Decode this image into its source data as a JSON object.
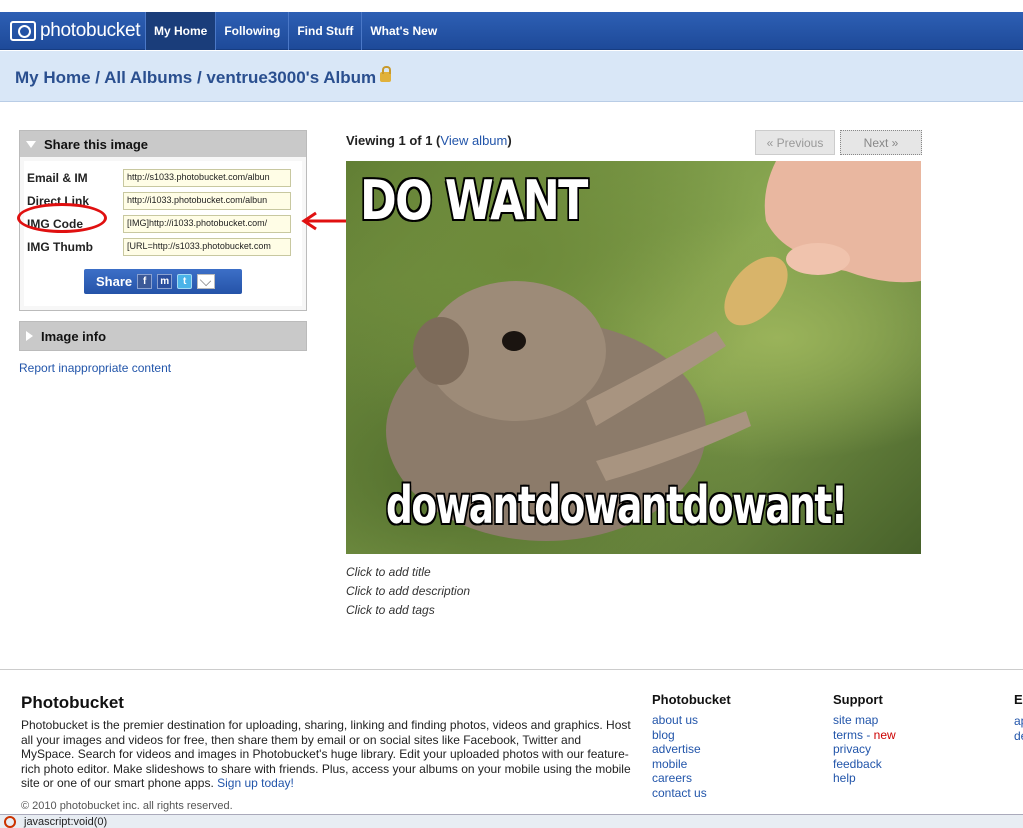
{
  "header": {
    "logo_text": "photobucket",
    "nav": [
      "My Home",
      "Following",
      "Find Stuff",
      "What's New"
    ]
  },
  "breadcrumb": {
    "text": "My Home / All Albums / ventrue3000's Album"
  },
  "share": {
    "title": "Share this image",
    "rows": [
      {
        "label": "Email & IM",
        "value": "http://s1033.photobucket.com/albun"
      },
      {
        "label": "Direct Link",
        "value": "http://i1033.photobucket.com/albun"
      },
      {
        "label": "IMG Code",
        "value": "[IMG]http://i1033.photobucket.com/"
      },
      {
        "label": "IMG Thumb",
        "value": "[URL=http://s1033.photobucket.com"
      }
    ],
    "button_label": "Share",
    "icons": [
      "facebook-icon",
      "myspace-icon",
      "twitter-icon",
      "email-icon"
    ]
  },
  "image_info": {
    "title": "Image info"
  },
  "report_link": "Report inappropriate content",
  "viewer": {
    "viewing_text": "Viewing 1 of 1 (",
    "view_album": "View album",
    "viewing_close": ")",
    "prev_label": "« Previous",
    "next_label": "Next »",
    "caption_top": "DO WANT",
    "caption_bottom": "dowantdowantdowant!",
    "add_title": "Click to add title",
    "add_description": "Click to add description",
    "add_tags": "Click to add tags"
  },
  "footer": {
    "title": "Photobucket",
    "about": "Photobucket is the premier destination for uploading, sharing, linking and finding photos, videos and graphics. Host all your images and videos for free, then share them by email or on social sites like Facebook, Twitter and MySpace. Search for videos and images in Photobucket's huge library. Edit your uploaded photos with our feature-rich photo editor. Make slideshows to share with friends. Plus, access your albums on your mobile using the mobile site or one of our smart phone apps.",
    "signup": "Sign up today!",
    "copyright": "© 2010 photobucket inc. all rights reserved.",
    "col1": {
      "heading": "Photobucket",
      "links": [
        "about us",
        "blog",
        "advertise",
        "mobile",
        "careers",
        "contact us"
      ]
    },
    "col2": {
      "heading": "Support",
      "links": [
        "site map",
        "terms - ",
        "privacy",
        "feedback",
        "help"
      ],
      "new_badge": "new"
    },
    "col3": {
      "heading": "E",
      "links": [
        "ap",
        "de"
      ]
    }
  },
  "status_bar": {
    "text": "javascript:void(0)"
  },
  "colors": {
    "nav_blue": "#2d5fb4",
    "link_blue": "#2255aa",
    "annotation_red": "#e01010"
  }
}
